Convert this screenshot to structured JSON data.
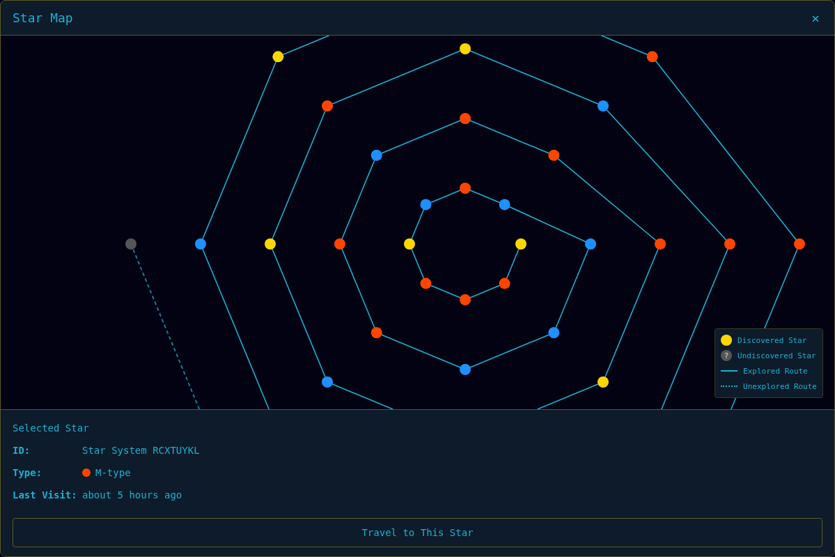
{
  "window": {
    "title": "Star Map",
    "close": "×"
  },
  "map": {
    "stars": [
      {
        "color": "#ffd700",
        "discovered": true
      },
      {
        "color": "#ff4500",
        "discovered": true
      },
      {
        "color": "#ff4500",
        "discovered": true
      },
      {
        "color": "#ff4500",
        "discovered": true
      },
      {
        "color": "#ffd700",
        "discovered": true
      },
      {
        "color": "#1e90ff",
        "discovered": true
      },
      {
        "color": "#ff4500",
        "discovered": true
      },
      {
        "color": "#1e90ff",
        "discovered": true
      },
      {
        "color": "#1e90ff",
        "discovered": true
      },
      {
        "color": "#1e90ff",
        "discovered": true
      },
      {
        "color": "#1e90ff",
        "discovered": true
      },
      {
        "color": "#ff4500",
        "discovered": true
      },
      {
        "color": "#ff4500",
        "discovered": true
      },
      {
        "color": "#1e90ff",
        "discovered": true
      },
      {
        "color": "#ff4500",
        "discovered": true
      },
      {
        "color": "#ff4500",
        "discovered": true
      },
      {
        "color": "#ff4500",
        "discovered": true
      },
      {
        "color": "#ffd700",
        "discovered": true
      },
      {
        "color": "#1e90ff",
        "discovered": true
      },
      {
        "color": "#ffd700",
        "discovered": true
      },
      {
        "color": "#ff4500",
        "discovered": true
      },
      {
        "color": "#ffd700",
        "discovered": true
      },
      {
        "color": "#1e90ff",
        "discovered": true
      },
      {
        "color": "#ff4500",
        "discovered": true
      },
      {
        "color": "#1e90ff",
        "discovered": true
      },
      {
        "color": "#ffd700",
        "discovered": true
      },
      {
        "color": "#ff4500",
        "discovered": true
      },
      {
        "color": "#ff4500",
        "discovered": true
      },
      {
        "color": "#555555",
        "discovered": false
      }
    ],
    "legend": [
      {
        "kind": "discovered-star",
        "label": "Discovered Star"
      },
      {
        "kind": "undiscovered-star",
        "label": "Undiscovered Star",
        "glyph": "?"
      },
      {
        "kind": "explored-route",
        "label": "Explored Route"
      },
      {
        "kind": "unexplored-route",
        "label": "Unexplored Route"
      }
    ]
  },
  "selected_star": {
    "heading": "Selected Star",
    "fields": [
      {
        "label": "ID:",
        "value": "Star System RCXTUYKL"
      },
      {
        "label": "Type:",
        "value": "M-type",
        "color": "#ff4500"
      },
      {
        "label": "Last Visit:",
        "value": "about 5 hours ago"
      }
    ],
    "button": "Travel to This Star"
  }
}
